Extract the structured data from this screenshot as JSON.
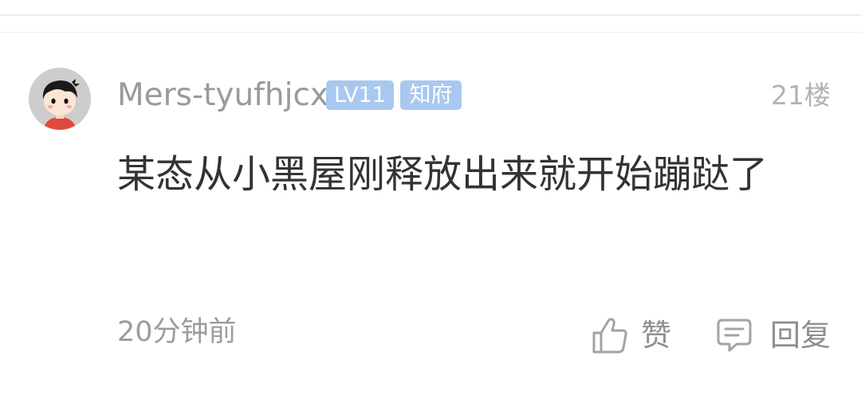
{
  "comment": {
    "username": "Mers-tyufhjcx",
    "level_badge": "LV11",
    "title_badge": "知府",
    "floor": "21楼",
    "content": "某态从小黑屋刚释放出来就开始蹦跶了",
    "time": "20分钟前",
    "like_label": "赞",
    "reply_label": "回复"
  },
  "icons": {
    "avatar": "cartoon-avatar",
    "like": "thumbs-up-icon",
    "reply": "comment-bubble-icon"
  },
  "colors": {
    "badge": "#a8c8ef",
    "muted_text": "#9a9a9a",
    "content_text": "#333333"
  }
}
